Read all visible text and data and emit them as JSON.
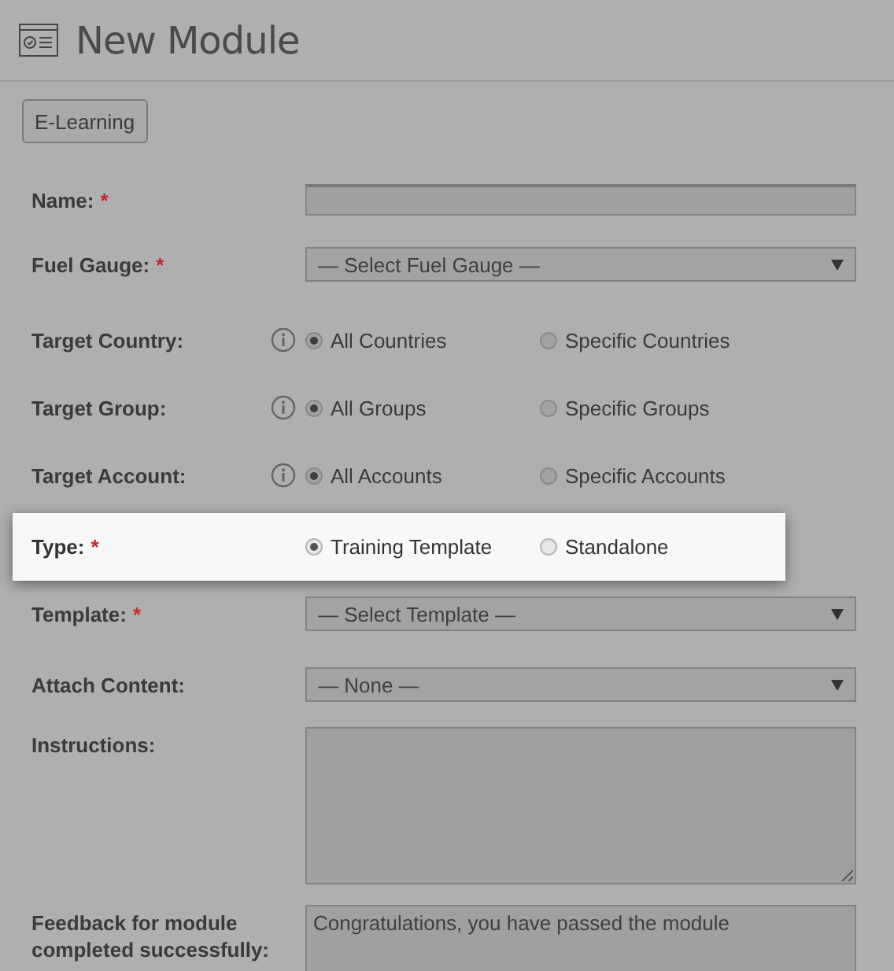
{
  "header": {
    "title": "New Module"
  },
  "toolbar": {
    "button": "E-Learning"
  },
  "fields": [
    {
      "kind": "text",
      "label": "Name:",
      "required_mark": "*"
    },
    {
      "kind": "select",
      "label": "Fuel Gauge:",
      "required_mark": "*",
      "value": "— Select Fuel Gauge —"
    },
    {
      "kind": "radio",
      "label": "Target Country:",
      "info": true,
      "options": [
        {
          "label": "All Countries",
          "selected": true
        },
        {
          "label": "Specific Countries",
          "selected": false
        }
      ]
    },
    {
      "kind": "radio",
      "label": "Target Group:",
      "info": true,
      "options": [
        {
          "label": "All Groups",
          "selected": true
        },
        {
          "label": "Specific Groups",
          "selected": false
        }
      ]
    },
    {
      "kind": "radio",
      "label": "Target Account:",
      "info": true,
      "options": [
        {
          "label": "All Accounts",
          "selected": true
        },
        {
          "label": "Specific Accounts",
          "selected": false
        }
      ]
    },
    {
      "kind": "radio",
      "label": "Type:",
      "required_mark": "*",
      "highlighted": true,
      "options": [
        {
          "label": "Training Template",
          "selected": true
        },
        {
          "label": "Standalone",
          "selected": false
        }
      ]
    },
    {
      "kind": "select",
      "label": "Template:",
      "required_mark": "*",
      "value": "— Select Template —"
    },
    {
      "kind": "select",
      "label": "Attach Content:",
      "value": "— None —"
    },
    {
      "kind": "textarea",
      "label": "Instructions:",
      "resizable": true
    },
    {
      "kind": "textarea",
      "label": "Feedback for module completed successfully:",
      "value": "Congratulations, you have passed the module"
    }
  ]
}
